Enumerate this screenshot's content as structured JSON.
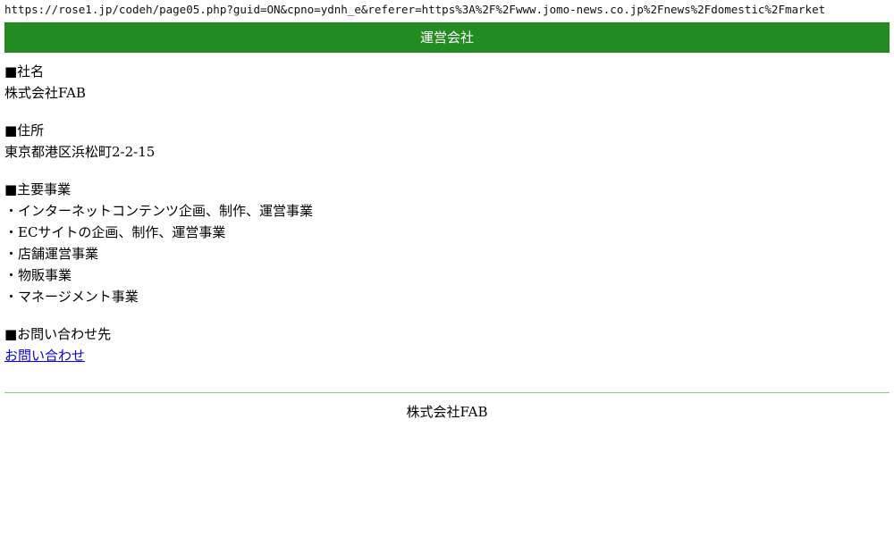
{
  "browser": {
    "url": "https://rose1.jp/codeh/page05.php?guid=ON&cpno=ydnh_e&referer=https%3A%2F%2Fwww.jomo-news.co.jp%2Fnews%2Fdomestic%2Fmarket"
  },
  "header": {
    "title": "運営会社",
    "background_color": "#228b22"
  },
  "company": {
    "label": "■社名",
    "value": "株式会社FAB"
  },
  "address": {
    "label": "■住所",
    "value": "東京都港区浜松町2-2-15"
  },
  "business": {
    "label": "■主要事業",
    "items": [
      "・インターネットコンテンツ企画、制作、運営事業",
      "・ECサイトの企画、制作、運営事業",
      "・店舗運営事業",
      "・物販事業",
      "・マネージメント事業"
    ]
  },
  "contact": {
    "label": "■お問い合わせ先",
    "link_text": "お問い合わせ",
    "link_color": "#0000ee"
  },
  "footer": {
    "text": "株式会社FAB",
    "divider_color": "#7ccf7c"
  }
}
